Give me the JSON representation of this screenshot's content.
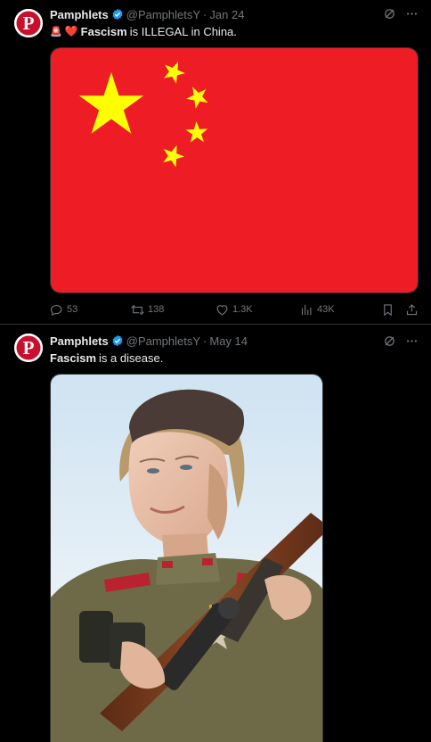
{
  "tweets": [
    {
      "author": {
        "name": "Pamphlets",
        "handle": "@PamphletsY",
        "avatar_letter": "P"
      },
      "date": "Jan 24",
      "text_emojis": [
        "🚨",
        "❤️"
      ],
      "text_bold": "Fascism",
      "text_rest": "is ILLEGAL in China.",
      "media": {
        "description": "flag-of-china",
        "colors": {
          "red": "#ee1c25",
          "yellow": "#ffff00"
        }
      },
      "stats": {
        "replies": "53",
        "reposts": "138",
        "likes": "1.3K",
        "views": "43K"
      }
    },
    {
      "author": {
        "name": "Pamphlets",
        "handle": "@PamphletsY",
        "avatar_letter": "P"
      },
      "date": "May 14",
      "text_bold": "Fascism",
      "text_rest": "is a disease.",
      "media": {
        "description": "colorized-photo-soviet-woman-sniper"
      }
    }
  ],
  "colors": {
    "avatar_red": "#c8102e",
    "verified_blue": "#1d9bf0",
    "muted": "#71767b",
    "text": "#e7e9ea",
    "border": "#2f3336"
  }
}
